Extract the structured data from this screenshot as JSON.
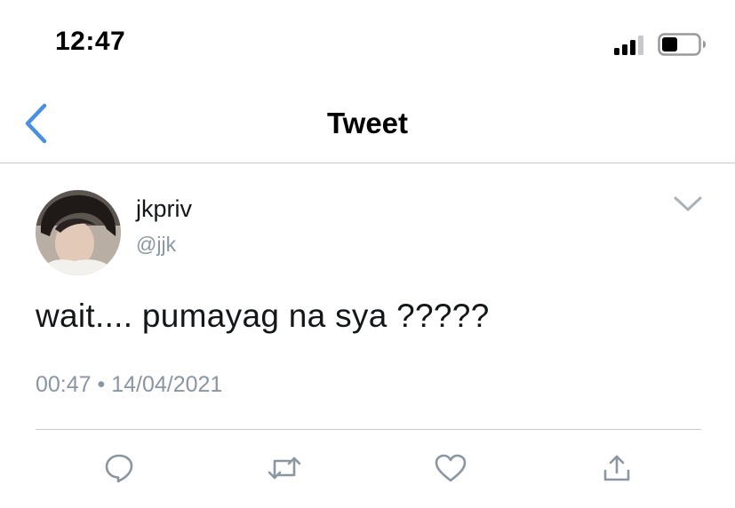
{
  "status_bar": {
    "time": "12:47"
  },
  "nav": {
    "title": "Tweet",
    "back_icon": "chevron-left-icon"
  },
  "tweet": {
    "display_name": "jkpriv",
    "handle": "@jjk",
    "text": "wait.... pumayag na sya ?????",
    "timestamp": "00:47 • 14/04/2021"
  },
  "actions": [
    {
      "name": "reply",
      "icon": "reply-icon"
    },
    {
      "name": "retweet",
      "icon": "retweet-icon"
    },
    {
      "name": "like",
      "icon": "heart-icon"
    },
    {
      "name": "share",
      "icon": "share-icon"
    }
  ],
  "colors": {
    "accent": "#4a90e2",
    "text": "#14171a",
    "secondary": "#8a96a3",
    "divider": "#c8c8cc"
  }
}
